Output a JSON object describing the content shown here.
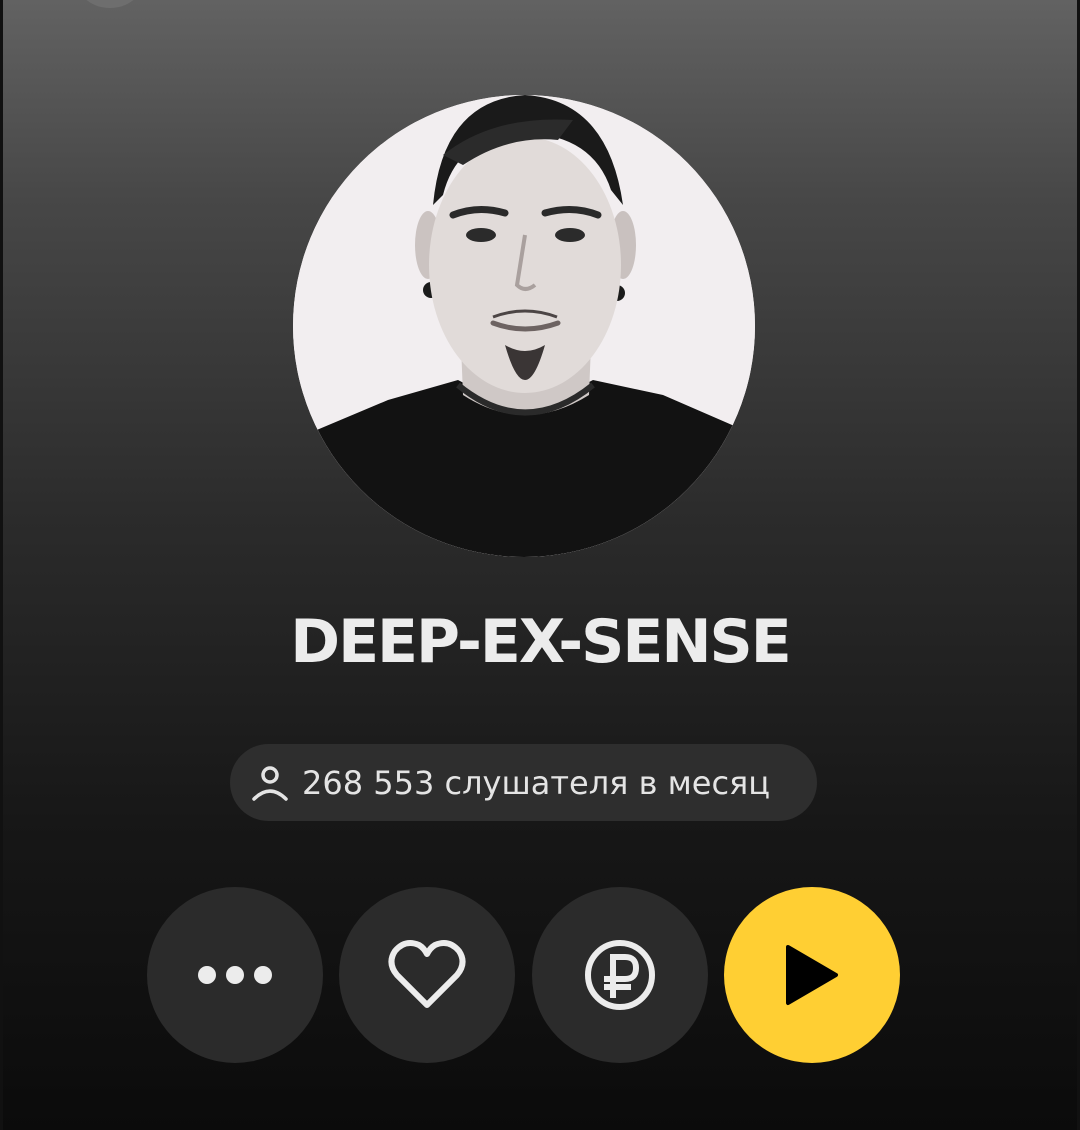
{
  "artist": {
    "name": "DEEP-EX-SENSE",
    "listeners": "268 553 слушателя в месяц"
  },
  "actions": [
    {
      "id": "more",
      "icon": "more-dots-icon"
    },
    {
      "id": "like",
      "icon": "heart-icon"
    },
    {
      "id": "donate",
      "icon": "ruble-icon"
    },
    {
      "id": "play",
      "icon": "play-icon"
    }
  ],
  "colors": {
    "accent": "#ffcf33",
    "button_bg": "#2b2b2b",
    "text": "#ececec"
  }
}
